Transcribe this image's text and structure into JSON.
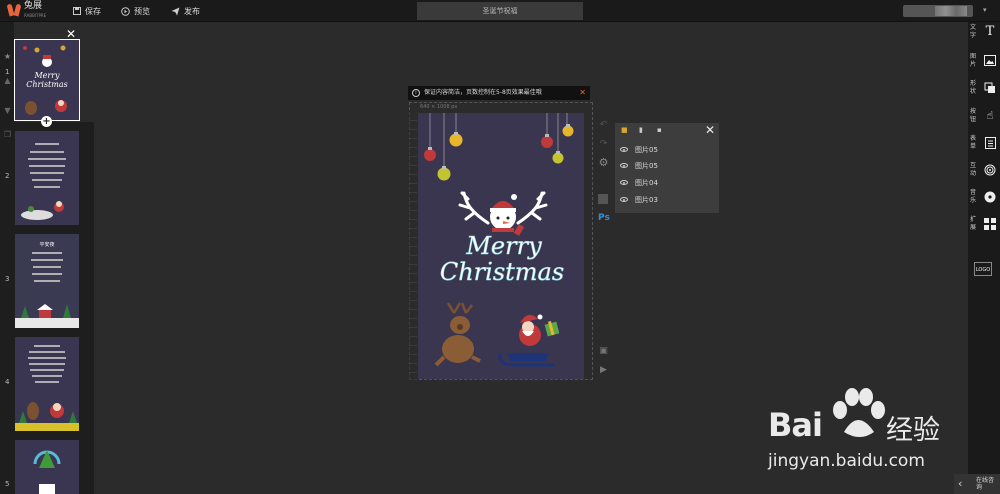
{
  "app": {
    "logo_text": "兔展",
    "logo_sub": "RABBITPRE",
    "doc_title": "圣诞节祝福"
  },
  "toolbar": {
    "save_label": "保存",
    "preview_label": "预览",
    "publish_label": "发布"
  },
  "pages": {
    "numbers": [
      "1",
      "2",
      "3",
      "4",
      "5"
    ],
    "thumb1": {
      "line1": "Merry",
      "line2": "Christmas"
    },
    "thumb3_title": "平安夜"
  },
  "notice": {
    "text": "保证内容简洁，页数控制在5-8页效果最佳哦"
  },
  "canvas": {
    "ruler_label": "640 × 1008 px",
    "title_line1": "Merry",
    "title_line2": "Christmas"
  },
  "layers": {
    "items": [
      {
        "name": "图片05"
      },
      {
        "name": "图片05"
      },
      {
        "name": "图片04"
      },
      {
        "name": "图片03"
      }
    ]
  },
  "right_sidebar": {
    "items": [
      {
        "label": "文字",
        "icon": "text-icon"
      },
      {
        "label": "图片",
        "icon": "image-icon"
      },
      {
        "label": "形状",
        "icon": "shape-icon"
      },
      {
        "label": "按钮",
        "icon": "hand-pointer-icon"
      },
      {
        "label": "表单",
        "icon": "form-icon"
      },
      {
        "label": "互动",
        "icon": "fingerprint-icon"
      },
      {
        "label": "音乐",
        "icon": "music-disc-icon"
      },
      {
        "label": "扩展",
        "icon": "grid-plus-icon"
      }
    ],
    "logo_label": "LOGO",
    "consult_label": "在线咨询"
  },
  "watermark": {
    "brand_left": "Bai",
    "brand_right": "经验",
    "url": "jingyan.baidu.com"
  },
  "colors": {
    "accent": "#e8643c",
    "canvas_bg": "#3b3650",
    "ps_blue": "#2f8fd8"
  }
}
